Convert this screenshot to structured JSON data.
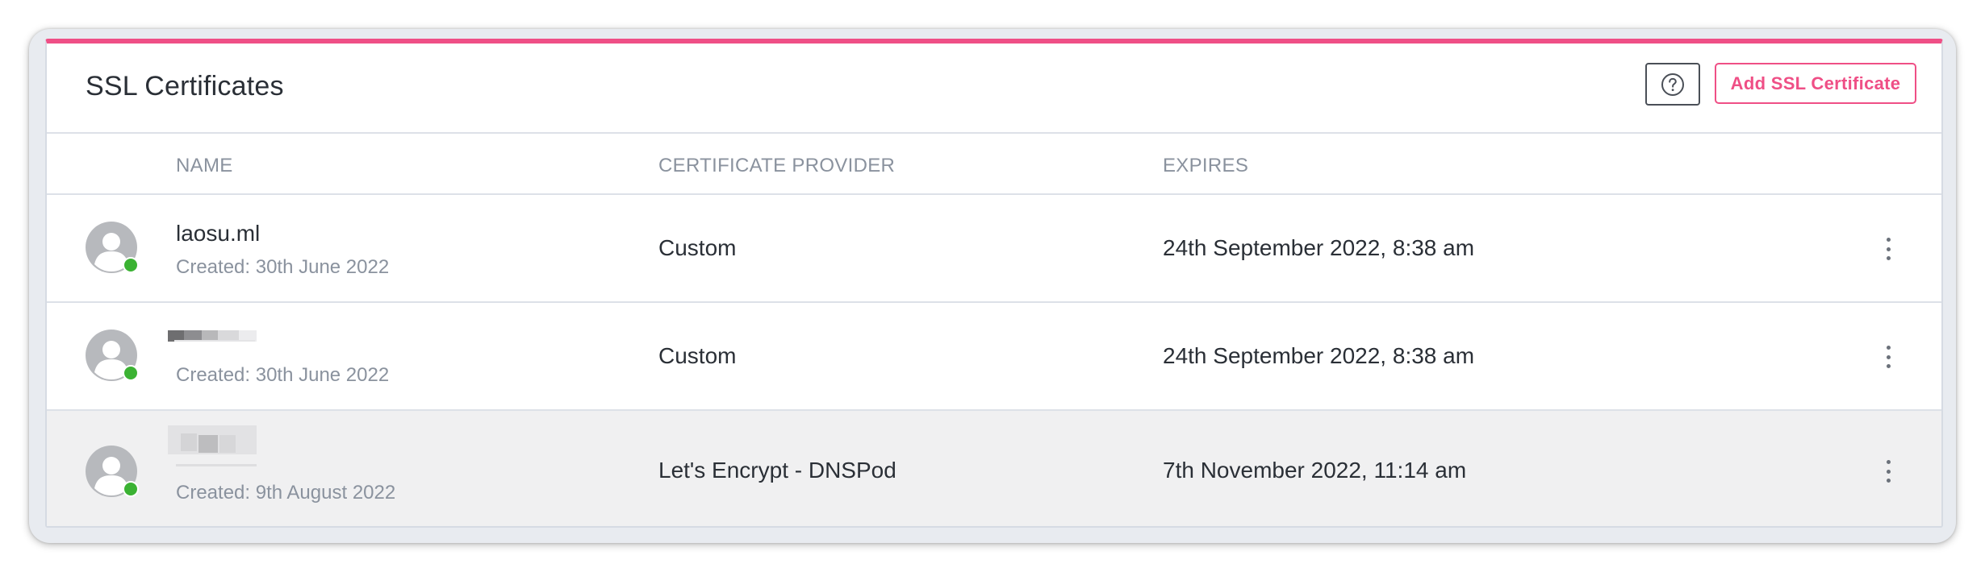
{
  "page": {
    "title": "SSL Certificates",
    "add_button_label": "Add SSL Certificate",
    "help_button_icon": "help-circle-icon"
  },
  "columns": {
    "name": "NAME",
    "provider": "CERTIFICATE PROVIDER",
    "expires": "EXPIRES"
  },
  "rows": [
    {
      "name": "laosu.ml",
      "created": "Created: 30th June 2022",
      "provider": "Custom",
      "expires": "24th September 2022, 8:38 am",
      "status": "active"
    },
    {
      "name": "",
      "created": "Created: 30th June 2022",
      "provider": "Custom",
      "expires": "24th September 2022, 8:38 am",
      "status": "active"
    },
    {
      "name": "",
      "created": "Created: 9th August 2022",
      "provider": "Let's Encrypt - DNSPod",
      "expires": "7th November 2022, 11:14 am",
      "status": "active"
    }
  ],
  "colors": {
    "accent": "#ef4f86",
    "status_active": "#3bb233",
    "muted_text": "#8a929e",
    "selected_row": "#f0f0f1"
  }
}
